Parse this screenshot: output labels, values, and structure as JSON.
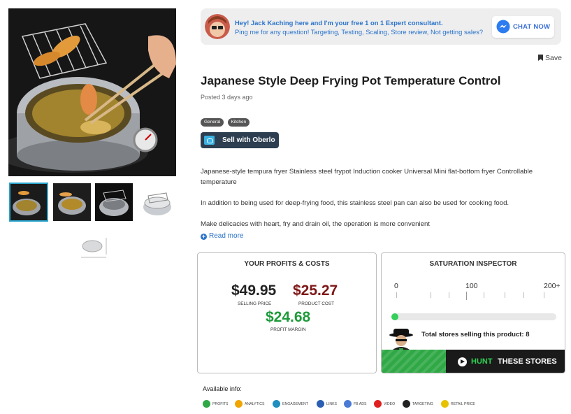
{
  "consultant": {
    "line1": "Hey! Jack Kaching here and I'm your free 1 on 1 Expert consultant.",
    "line2": "Ping me for any question! Targeting, Testing, Scaling, Store review, Not getting sales?",
    "chat_label": "CHAT NOW"
  },
  "save_label": "Save",
  "product": {
    "title": "Japanese Style Deep Frying Pot Temperature Control",
    "posted": "Posted 3 days ago",
    "tags": [
      "General",
      "Kitchen"
    ],
    "oberlo_label": "Sell with Oberlo",
    "description": [
      "Japanese-style tempura fryer Stainless steel frypot Induction cooker Universal Mini flat-bottom fryer Controllable temperature",
      "In addition to being used for deep-frying food, this stainless steel pan can also be used for cooking food.",
      "Make delicacies with heart, fry and drain oil, the operation is more convenient"
    ],
    "read_more": "Read more"
  },
  "profits": {
    "title": "YOUR PROFITS & COSTS",
    "selling_price": "$49.95",
    "selling_label": "SELLING PRICE",
    "product_cost": "$25.27",
    "cost_label": "PRODUCT COST",
    "margin": "$24.68",
    "margin_label": "PROFIT MARGIN"
  },
  "saturation": {
    "title": "SATURATION INSPECTOR",
    "scale": [
      "0",
      "100",
      "200+"
    ],
    "stores_text": "Total stores selling this product: 8",
    "stores_fraction": 0.04,
    "hunt_part1": "HUNT",
    "hunt_part2": "THESE STORES"
  },
  "available_info": {
    "title": "Available info:",
    "items": [
      {
        "label": "PROFITS",
        "color": "#2fa845"
      },
      {
        "label": "ANALYTICS",
        "color": "#f0a500"
      },
      {
        "label": "ENGAGEMENT",
        "color": "#1f8fbf"
      },
      {
        "label": "LINKS",
        "color": "#2b5fb4"
      },
      {
        "label": "FB ADS",
        "color": "#4a7ad6"
      },
      {
        "label": "VIDEO",
        "color": "#e02020"
      },
      {
        "label": "TARGETING",
        "color": "#222222"
      },
      {
        "label": "RETAIL PRICE",
        "color": "#e6c200"
      }
    ]
  }
}
